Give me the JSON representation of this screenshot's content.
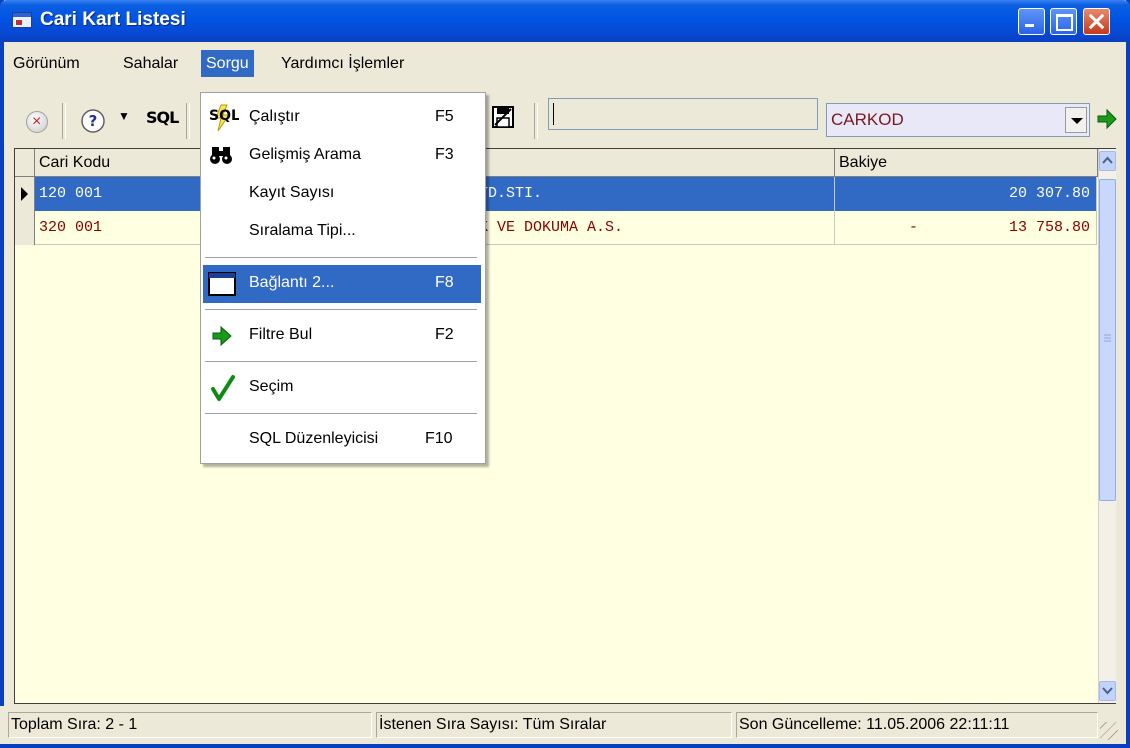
{
  "window": {
    "title": "Cari Kart Listesi"
  },
  "menu": [
    "Görünüm",
    "Sahalar",
    "Sorgu",
    "Yardımcı İşlemler"
  ],
  "toolbar": {
    "sql_label": "SQL",
    "field_combo_value": "CARKOD"
  },
  "dropdown": {
    "items": [
      {
        "label": "Çalıştır",
        "shortcut": "F5"
      },
      {
        "label": "Gelişmiş Arama",
        "shortcut": "F3"
      },
      {
        "label": "Kayıt Sayısı",
        "shortcut": ""
      },
      {
        "label": "Sıralama Tipi...",
        "shortcut": ""
      },
      {
        "label": "Bağlantı 2...",
        "shortcut": "F8"
      },
      {
        "label": "Filtre Bul",
        "shortcut": "F2"
      },
      {
        "label": "Seçim",
        "shortcut": ""
      },
      {
        "label": "SQL Düzenleyicisi",
        "shortcut": "F10"
      }
    ]
  },
  "grid": {
    "columns": [
      "Cari Kodu",
      "Bakiye"
    ],
    "rows": [
      {
        "code": "120 001",
        "name_fragment": "TD.STI.",
        "sign": "",
        "balance": "20 307.80"
      },
      {
        "code": "320 001",
        "name_fragment": "K VE DOKUMA A.S.",
        "sign": "-",
        "balance": "13 758.80"
      }
    ]
  },
  "status": {
    "total": "Toplam Sıra: 2 - 1",
    "requested": "İstenen Sıra Sayısı: Tüm Sıralar",
    "updated": "Son Güncelleme: 11.05.2006 22:11:11"
  },
  "colors": {
    "title_blue": "#0054e3",
    "selection": "#316ac5",
    "grid_bg": "#ffffe1",
    "row_text": "#8b0000"
  }
}
